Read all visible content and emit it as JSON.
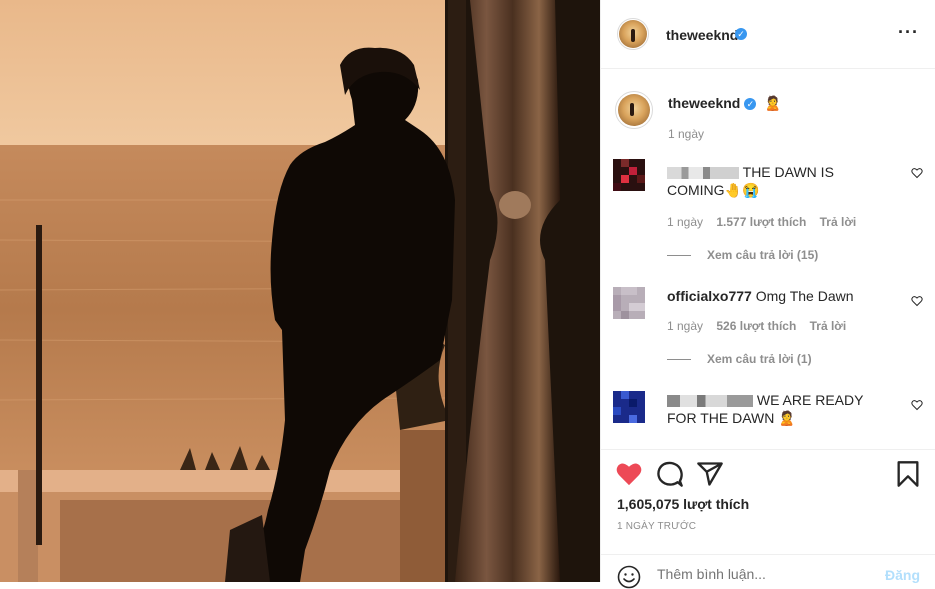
{
  "post": {
    "username": "theweeknd",
    "caption_emoji": "🧑‍🦲"
  },
  "caption": {
    "username": "theweeknd",
    "emoji": "🙎",
    "age": "1 ngày"
  },
  "comments": [
    {
      "text": "THE DAWN IS COMING🤚😭",
      "age": "1 ngày",
      "likes": "1.577 lượt thích",
      "reply": "Trả lời",
      "view_replies": "Xem câu trả lời (15)"
    },
    {
      "username": "officialxo777",
      "text": "Omg The Dawn",
      "age": "1 ngày",
      "likes": "526 lượt thích",
      "reply": "Trả lời",
      "view_replies": "Xem câu trả lời (1)"
    },
    {
      "text": "WE ARE READY FOR THE DAWN 🙎"
    }
  ],
  "likes_count": "1,605,075 lượt thích",
  "time_ago": "1 NGÀY TRƯỚC",
  "comment_box": {
    "placeholder": "Thêm bình luận...",
    "post_label": "Đăng"
  },
  "colors": {
    "like_red": "#ed4956",
    "verified_blue": "#3897f0",
    "post_button_disabled": "#b2dffc"
  },
  "icons": [
    "more-options-icon",
    "verified-icon",
    "heart-icon",
    "comment-icon",
    "share-icon",
    "bookmark-icon",
    "emoji-icon"
  ]
}
